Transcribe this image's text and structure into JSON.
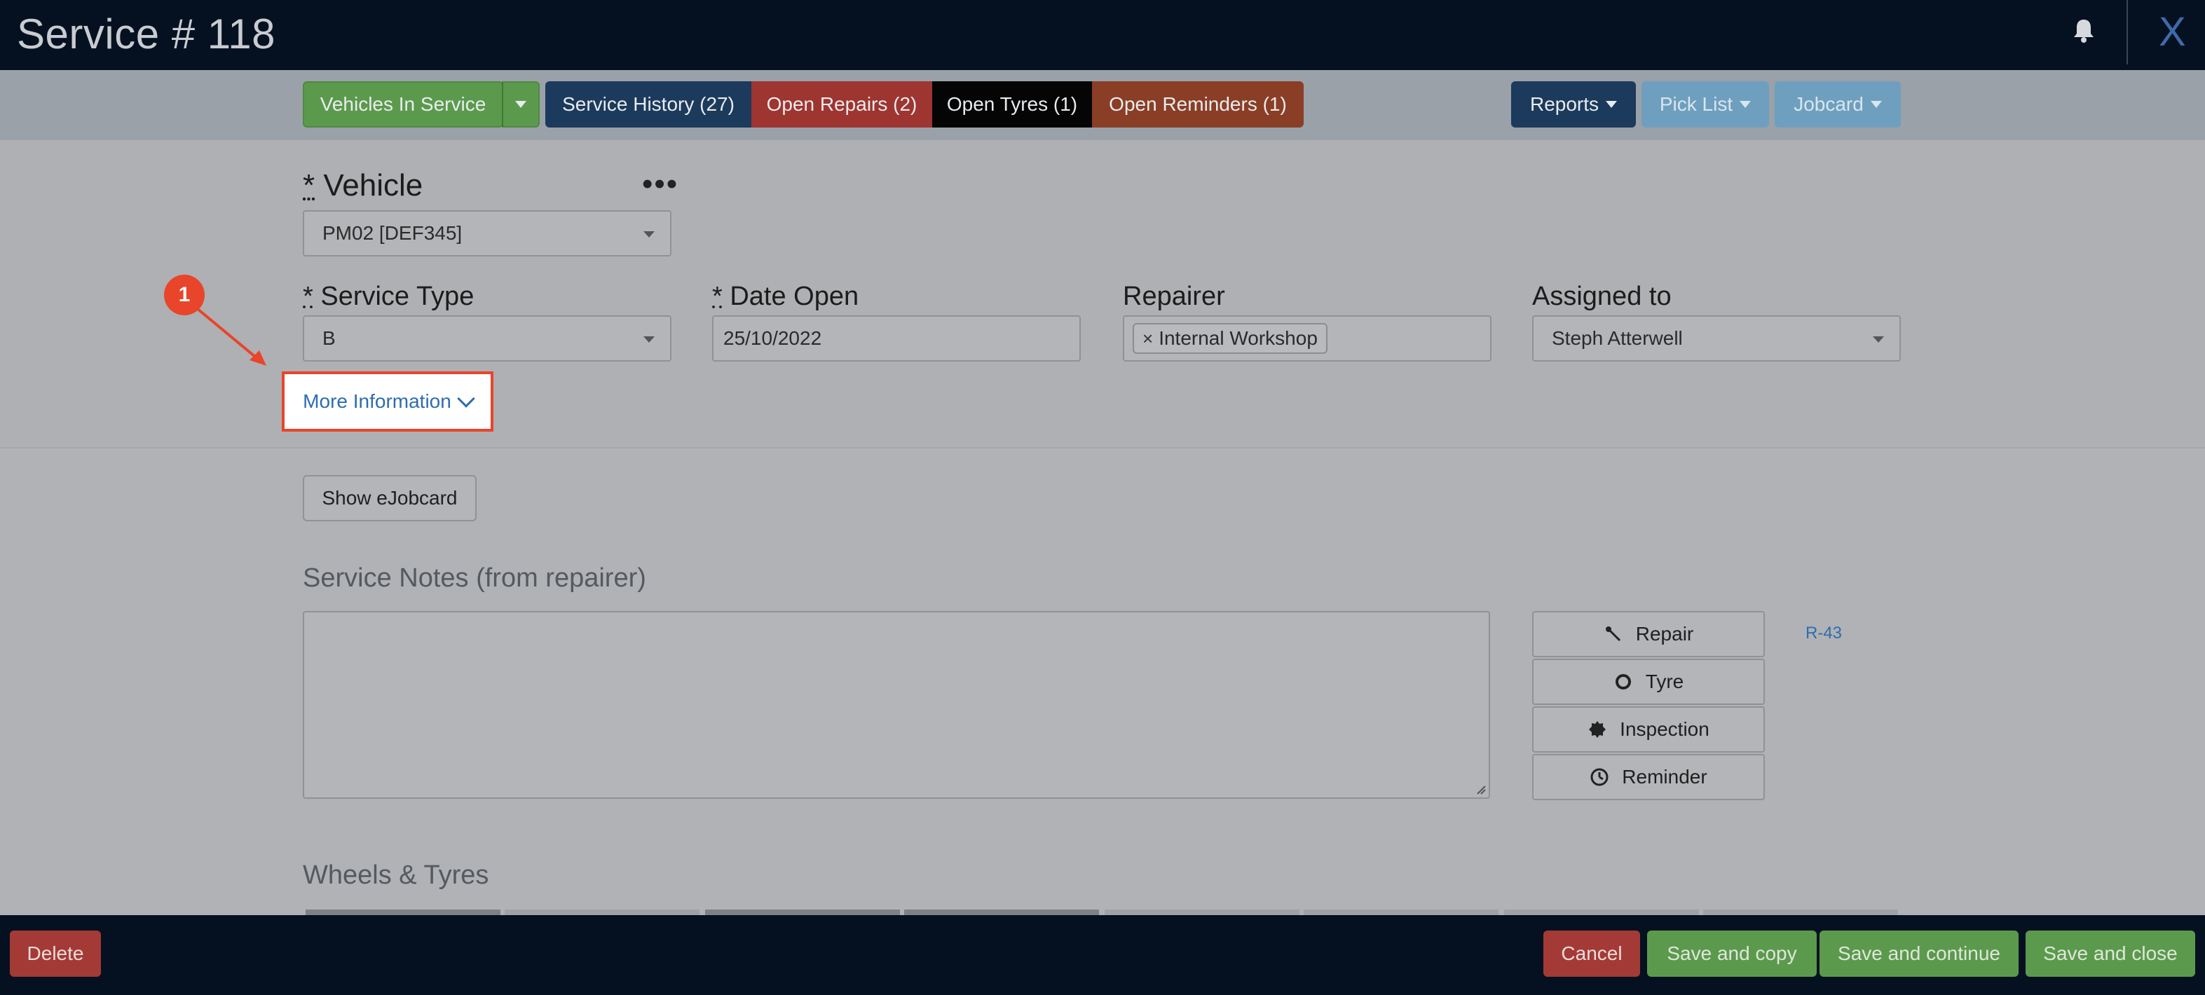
{
  "header": {
    "title": "Service # 118",
    "close_label": "X"
  },
  "tabs": {
    "vehicles_in_service": "Vehicles In Service",
    "service_history": "Service History (27)",
    "open_repairs": "Open Repairs (2)",
    "open_tyres": "Open Tyres (1)",
    "open_reminders": "Open Reminders (1)",
    "reports": "Reports",
    "pick_list": "Pick List",
    "jobcard": "Jobcard"
  },
  "form": {
    "vehicle_label": "Vehicle",
    "vehicle_value": "PM02 [DEF345]",
    "required_mark": "*",
    "service_type_label": "Service Type",
    "service_type_value": "B",
    "date_open_label": "Date Open",
    "date_open_value": "25/10/2022",
    "repairer_label": "Repairer",
    "repairer_chip": "Internal Workshop",
    "assigned_label": "Assigned to",
    "assigned_value": "Steph Atterwell",
    "more_info": "More Information",
    "ellipsis": "•••"
  },
  "annotation": {
    "step": "1"
  },
  "lower": {
    "show_ejobcard": "Show eJobcard",
    "service_notes_title": "Service Notes (from repairer)",
    "repair": "Repair",
    "tyre": "Tyre",
    "inspection": "Inspection",
    "reminder": "Reminder",
    "ref": "R-43",
    "wheels_title": "Wheels & Tyres"
  },
  "footer": {
    "delete": "Delete",
    "cancel": "Cancel",
    "save_copy": "Save and copy",
    "save_continue": "Save and continue",
    "save_close": "Save and close"
  },
  "colors": {
    "accent_annotation": "#e8452a",
    "link": "#2e6cb0",
    "header_bg": "#051121"
  }
}
